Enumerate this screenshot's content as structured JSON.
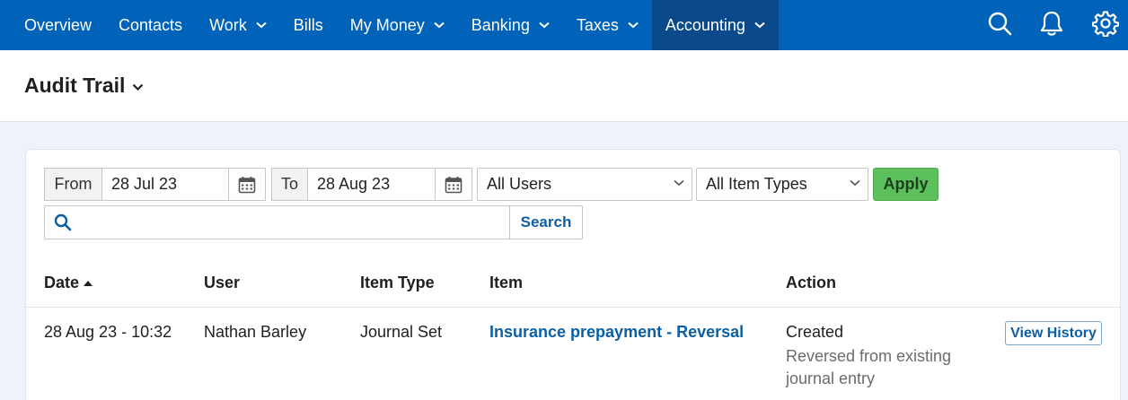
{
  "nav": {
    "items": [
      {
        "label": "Overview",
        "has_menu": false
      },
      {
        "label": "Contacts",
        "has_menu": false
      },
      {
        "label": "Work",
        "has_menu": true
      },
      {
        "label": "Bills",
        "has_menu": false
      },
      {
        "label": "My Money",
        "has_menu": true
      },
      {
        "label": "Banking",
        "has_menu": true
      },
      {
        "label": "Taxes",
        "has_menu": true
      },
      {
        "label": "Accounting",
        "has_menu": true,
        "active": true
      }
    ],
    "icons": [
      "search-icon",
      "bell-icon",
      "gear-icon"
    ]
  },
  "header": {
    "title": "Audit Trail"
  },
  "filters": {
    "from_label": "From",
    "from_value": "28 Jul 23",
    "to_label": "To",
    "to_value": "28 Aug 23",
    "users_selected": "All Users",
    "item_types_selected": "All Item Types",
    "apply_label": "Apply",
    "search_label": "Search",
    "search_value": ""
  },
  "table": {
    "headers": {
      "date": "Date",
      "user": "User",
      "item_type": "Item Type",
      "item": "Item",
      "action": "Action"
    },
    "rows": [
      {
        "date": "28 Aug 23 - 10:32",
        "user": "Nathan Barley",
        "item_type": "Journal Set",
        "item": "Insurance prepayment - Reversal",
        "action": "Created",
        "action_detail": "Reversed from existing journal entry",
        "history_label": "View History"
      }
    ]
  },
  "colors": {
    "nav_bg": "#0062b8",
    "nav_active": "#0b4a8a",
    "link": "#0b5fa5",
    "apply": "#5cc05c"
  }
}
